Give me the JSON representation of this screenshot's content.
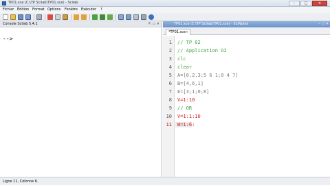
{
  "window": {
    "title": "TP01.sce (C:\\TP Scilab\\TP01.sce) - Scilab"
  },
  "menu": [
    "Fichier",
    "Édition",
    "Format",
    "Options",
    "Fenêtre",
    "Exécuter",
    "?"
  ],
  "console": {
    "title": "Console Scilab 5.4.1",
    "prompt": "-->"
  },
  "editor": {
    "title": "TP01.sce (C:\\TP Scilab\\TP01.sce) - SciNotes",
    "tab": "*TP01.sce",
    "lines": [
      {
        "n": "1",
        "text": "// TP 02"
      },
      {
        "n": "2",
        "text": "// Application OI"
      },
      {
        "n": "3",
        "text": "clc"
      },
      {
        "n": "4",
        "text": "clear"
      },
      {
        "n": "5",
        "text": "A=[0,2,3;5 6 1;0 4 7]"
      },
      {
        "n": "6",
        "text": "B=[4,6,1]"
      },
      {
        "n": "7",
        "text": "E=[3;1;0;8]"
      },
      {
        "n": "8",
        "text": "V=1:10"
      },
      {
        "n": "9",
        "text": "// OR"
      },
      {
        "n": "10",
        "text": "V=1:1:10"
      },
      {
        "n": "11",
        "text": "W=1:6:"
      }
    ]
  },
  "status": {
    "text": "Ligne 11, Colonne 6."
  }
}
